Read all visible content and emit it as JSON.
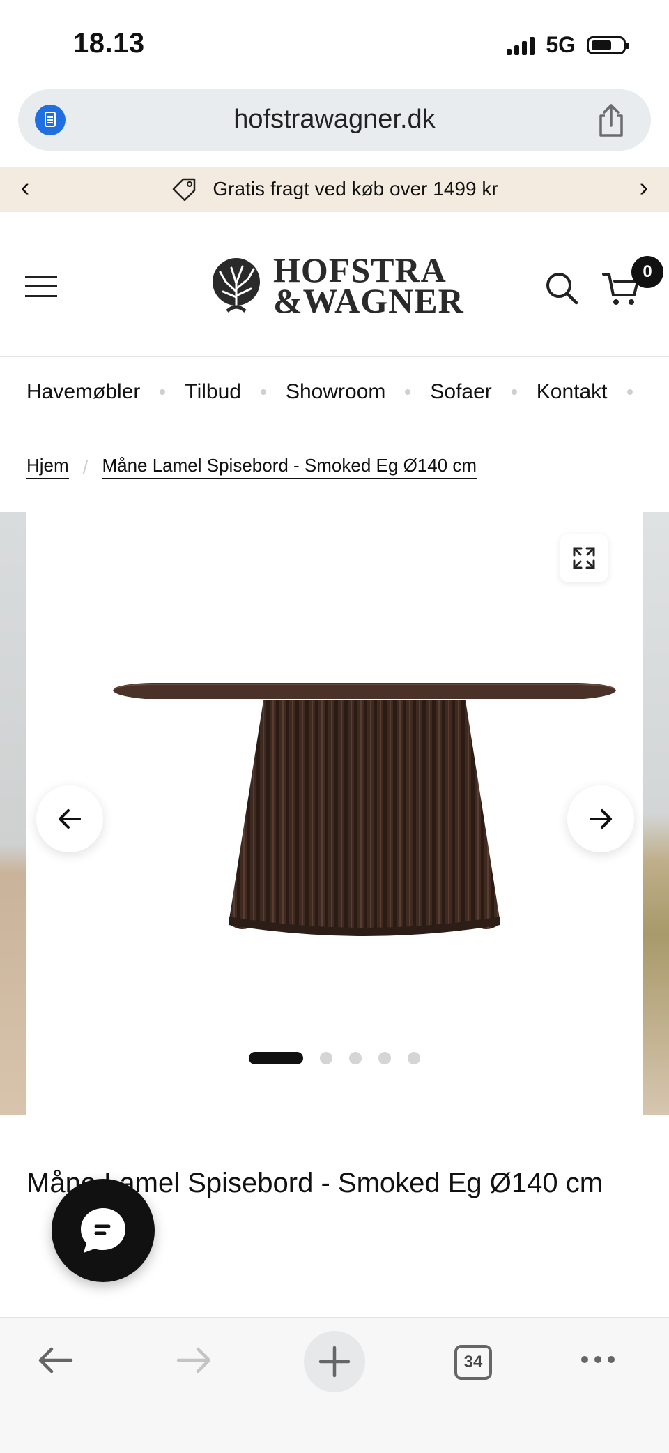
{
  "status": {
    "time": "18.13",
    "network": "5G",
    "battery_level": 0.6
  },
  "browser": {
    "url": "hofstrawagner.dk",
    "open_tabs": "34"
  },
  "promo": {
    "text": "Gratis fragt ved køb over 1499 kr"
  },
  "header": {
    "logo_line1": "HOFSTRA",
    "logo_line2": "&WAGNER",
    "cart_count": "0"
  },
  "nav": {
    "items": [
      "Havemøbler",
      "Tilbud",
      "Showroom",
      "Sofaer",
      "Kontakt"
    ]
  },
  "breadcrumb": {
    "home": "Hjem",
    "current": "Måne Lamel Spisebord - Smoked Eg Ø140 cm"
  },
  "gallery": {
    "slide_count": 5,
    "active_slide": 1
  },
  "product": {
    "title": "Måne Lamel Spisebord - Smoked Eg Ø140 cm"
  },
  "icons": {
    "reader": "reader-icon",
    "share": "share-icon",
    "tag": "tag-icon",
    "menu": "hamburger-menu-icon",
    "search": "search-icon",
    "cart": "cart-icon",
    "expand": "expand-icon",
    "chat": "chat-icon"
  },
  "colors": {
    "promo_bg": "#f3ebdf",
    "accent_blue": "#1f6fe0",
    "price_red": "#d0312d",
    "dark": "#111111"
  }
}
